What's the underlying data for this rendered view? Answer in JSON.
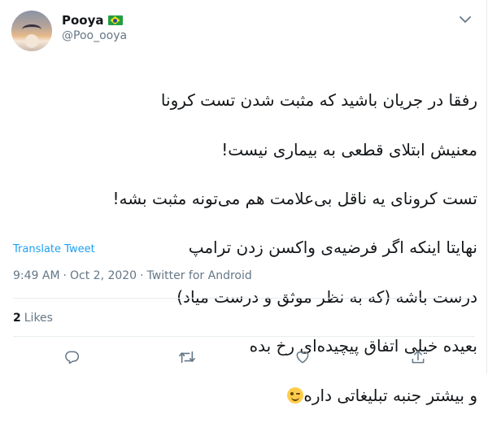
{
  "author": {
    "display_name": "Pooya",
    "handle": "@Poo_ooya",
    "flag_icon": "brazil-flag-icon"
  },
  "tweet": {
    "lines": [
      "رفقا در جریان باشید که مثبت شدن تست کرونا",
      "معنیش ابتلای قطعی به بیماری نیست!",
      "تست کرونای یه ناقل بی‌علامت هم می‌تونه مثبت بشه!",
      "نهایتا اینکه اگر فرضیه‌ی واکسن زدن ترامپ",
      "درست باشه (که به نظر موثق و درست میاد)",
      "بعیده خیلی اتفاق پیچیده‌ای رخ بده",
      "و بیشتر جنبه تبلیغاتی داره"
    ],
    "emoji": "winking-face-emoji"
  },
  "translate_label": "Translate Tweet",
  "meta": {
    "time": "9:49 AM",
    "separator": "·",
    "date": "Oct 2, 2020",
    "source": "Twitter for Android"
  },
  "engagement": {
    "likes_count": "2",
    "likes_label": "Likes"
  },
  "actions": [
    "reply-icon",
    "retweet-icon",
    "like-icon",
    "share-icon"
  ],
  "colors": {
    "link": "#1da1f2",
    "secondary_text": "#657786",
    "primary_text": "#14171a",
    "divider": "#e6ecf0"
  }
}
